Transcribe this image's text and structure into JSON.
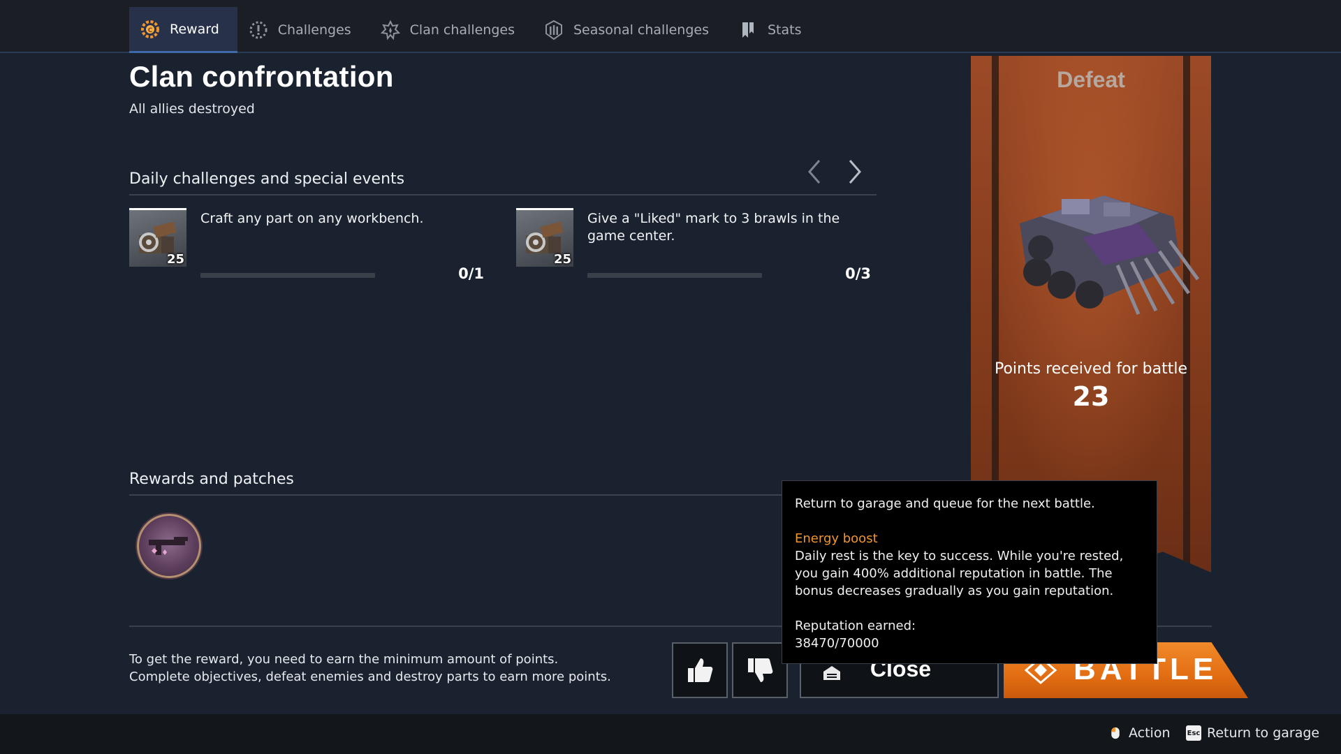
{
  "tabs": [
    {
      "label": "Reward",
      "icon": "reward-gear-icon",
      "active": true
    },
    {
      "label": "Challenges",
      "icon": "challenges-icon",
      "active": false
    },
    {
      "label": "Clan challenges",
      "icon": "clan-challenges-icon",
      "active": false
    },
    {
      "label": "Seasonal challenges",
      "icon": "seasonal-challenges-icon",
      "active": false
    },
    {
      "label": "Stats",
      "icon": "stats-bookmark-icon",
      "active": false
    }
  ],
  "header": {
    "title": "Clan confrontation",
    "subtitle": "All allies destroyed"
  },
  "daily": {
    "heading": "Daily challenges and special events",
    "challenges": [
      {
        "text": "Craft any part on any workbench.",
        "reward_qty": "25",
        "progress": "0/1",
        "progress_fraction": 0
      },
      {
        "text": "Give a \"Liked\" mark to 3 brawls in the game center.",
        "reward_qty": "25",
        "progress": "0/3",
        "progress_fraction": 0
      }
    ]
  },
  "rewards": {
    "heading": "Rewards and patches"
  },
  "bottom_note": {
    "line1": "To get the reward, you need to earn the minimum amount of points.",
    "line2": "Complete objectives, defeat enemies and destroy parts to earn more points."
  },
  "buttons": {
    "close_label": "Close",
    "battle_label": "BATTLE"
  },
  "banner": {
    "result": "Defeat",
    "points_label": "Points received for battle",
    "points_value": "23"
  },
  "tooltip": {
    "line1": "Return to garage and queue for the next battle.",
    "boost_title": "Energy boost",
    "boost_text": "Daily rest is the key to success. While you're rested, you gain 400% additional reputation in battle. The bonus decreases gradually as you gain reputation.",
    "rep_label": "Reputation earned:",
    "rep_value": "38470/70000"
  },
  "footer": {
    "action_label": "Action",
    "return_key": "Esc",
    "return_label": "Return to garage"
  },
  "colors": {
    "accent_orange": "#f0962e",
    "battle_orange": "#e36d12",
    "active_tab": "#27324a",
    "background": "#1a2230"
  }
}
